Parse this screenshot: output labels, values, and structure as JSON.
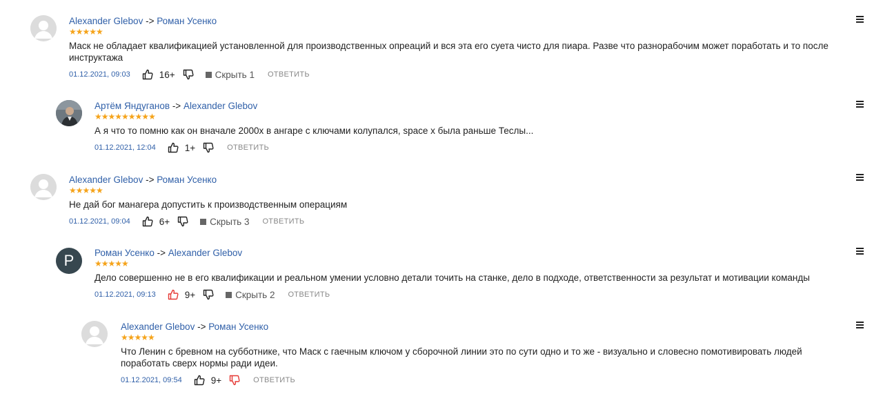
{
  "comments": [
    {
      "author": "Alexander Glebov",
      "arrow": "->",
      "reply_to": "Роман Усенко",
      "stars": "★★★★★",
      "text": "Маск не обладает квалификацией установленной для производственных опреаций и вся эта его суета чисто для пиара. Разве что разнорабочим может поработать и то после инструктажа",
      "date": "01.12.2021, 09:03",
      "likes": "16+",
      "hide": "Скрыть 1",
      "reply": "ОТВЕТИТЬ",
      "avatar_letter": ""
    },
    {
      "author": "Артём Яндуганов",
      "arrow": "->",
      "reply_to": "Alexander Glebov",
      "stars": "★★★★★★★★★",
      "text": "А я что то помню как он вначале 2000х в ангаре с ключами колупался, space x была раньше Теслы...",
      "date": "01.12.2021, 12:04",
      "likes": "1+",
      "hide": "",
      "reply": "ОТВЕТИТЬ",
      "avatar_letter": ""
    },
    {
      "author": "Alexander Glebov",
      "arrow": "->",
      "reply_to": "Роман Усенко",
      "stars": "★★★★★",
      "text": "Не дай бог манагера допустить к производственным операциям",
      "date": "01.12.2021, 09:04",
      "likes": "6+",
      "hide": "Скрыть 3",
      "reply": "ОТВЕТИТЬ",
      "avatar_letter": ""
    },
    {
      "author": "Роман Усенко",
      "arrow": "->",
      "reply_to": "Alexander Glebov",
      "stars": "★★★★★",
      "text": "Дело совершенно не в его квалификации и реальном умении условно детали точить на станке, дело в подходе, ответственности за результат и мотивации команды",
      "date": "01.12.2021, 09:13",
      "likes": "9+",
      "hide": "Скрыть 2",
      "reply": "ОТВЕТИТЬ",
      "avatar_letter": "Р"
    },
    {
      "author": "Alexander Glebov",
      "arrow": "->",
      "reply_to": "Роман Усенко",
      "stars": "★★★★★",
      "text": "Что Ленин с бревном на субботнике, что Маск с гаечным ключом у сборочной линии это по сути одно и то же - визуально и словесно помотивировать людей поработать сверх нормы ради идеи.",
      "date": "01.12.2021, 09:54",
      "likes": "9+",
      "hide": "",
      "reply": "ОТВЕТИТЬ",
      "avatar_letter": ""
    }
  ],
  "colors": {
    "link": "#2f5fa8",
    "star": "#f5a31a",
    "like_active": "#e53935",
    "dislike_active": "#e53935"
  }
}
